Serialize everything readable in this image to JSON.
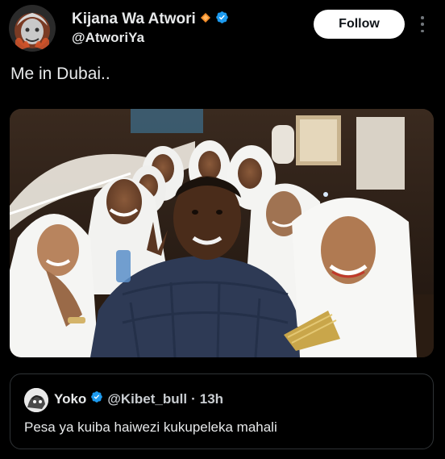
{
  "author": {
    "display_name": "Kijana Wa Atwori",
    "handle": "@AtworiYa",
    "follow_label": "Follow"
  },
  "tweet": {
    "text": "Me in Dubai.."
  },
  "quoted": {
    "display_name": "Yoko",
    "handle": "@Kibet_bull",
    "separator": "·",
    "time": "13h",
    "text": "Pesa ya kuiba haiwezi kukupeleka mahali"
  },
  "colors": {
    "background": "#000000",
    "verified": "#1d9bf0",
    "badge_orange": "#f28c28",
    "follow_bg": "#ffffff"
  },
  "icons": {
    "verified": "verified-badge-icon",
    "affiliate": "orange-diamond-icon",
    "more": "more-options-icon"
  }
}
